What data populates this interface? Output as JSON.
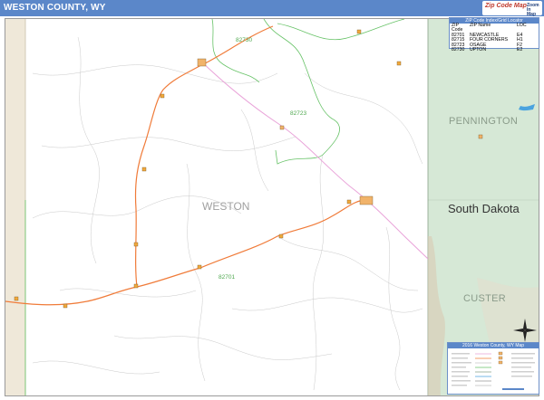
{
  "header": {
    "title": "WESTON COUNTY, WY"
  },
  "logo": {
    "brand": "Zip Code Map",
    "sub": "Zoom In Map"
  },
  "zip_table": {
    "heading": "ZIP Code Index/Grid Locator",
    "columns": [
      "ZIP Code",
      "ZIP Name",
      "LOC"
    ],
    "rows": [
      [
        "82701",
        "NEWCASTLE",
        "E4"
      ],
      [
        "82715",
        "FOUR CORNERS",
        "H1"
      ],
      [
        "82723",
        "OSAGE",
        "F2"
      ],
      [
        "82730",
        "UPTON",
        "E2"
      ]
    ]
  },
  "labels": {
    "county": "WESTON",
    "state": "South Dakota",
    "adjacent_north": "PENNINGTON",
    "adjacent_south": "CUSTER",
    "zip_a": "82730",
    "zip_b": "82723",
    "zip_c": "82701"
  },
  "legend": {
    "heading": "2016 Weston County, WY Map"
  },
  "colors": {
    "title_bar": "#5b87c9",
    "map_land": "#ffffff",
    "adjacent_land": "#d6e8d6",
    "left_strip": "#efe8d9",
    "highway": "#f07b39",
    "interstate": "#e9a3d9",
    "zip_boundary": "#66c266",
    "water": "#4aa3df",
    "roads": "#c9c9c9"
  }
}
